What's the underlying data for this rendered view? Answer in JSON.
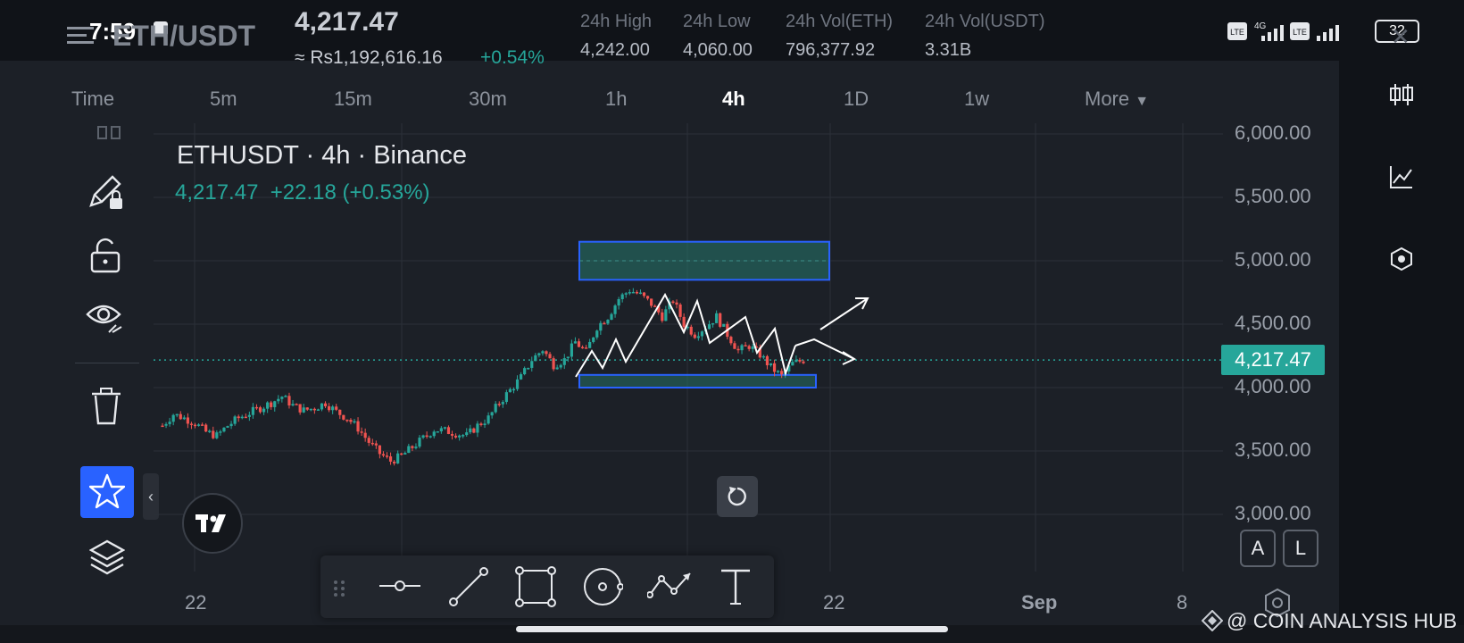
{
  "status": {
    "time": "7:59",
    "battery": "32",
    "net": "4G"
  },
  "header": {
    "symbol": "ETH/USDT",
    "price": "4,217.47",
    "fiat_price": "≈ Rs1,192,616.16",
    "change": "+0.54%",
    "stats": [
      {
        "label": "24h High",
        "value": "4,242.00"
      },
      {
        "label": "24h Low",
        "value": "4,060.00"
      },
      {
        "label": "24h Vol(ETH)",
        "value": "796,377.92"
      },
      {
        "label": "24h Vol(USDT)",
        "value": "3.31B"
      }
    ]
  },
  "timeframes": [
    "Time",
    "5m",
    "15m",
    "30m",
    "1h",
    "4h",
    "1D",
    "1w",
    "More"
  ],
  "active_timeframe": "4h",
  "legend": {
    "title": "ETHUSDT · 4h · Binance",
    "ohlc": "4,217.47  +22.18 (+0.53%)"
  },
  "price_axis": [
    "6,000.00",
    "5,500.00",
    "5,000.00",
    "4,500.00",
    "4,000.00",
    "3,500.00",
    "3,000.00"
  ],
  "time_axis": [
    "22",
    "22",
    "Sep",
    "8"
  ],
  "last_price_tag": "4,217.47",
  "scale_buttons": {
    "auto": "A",
    "log": "L"
  },
  "watermark": "@ COIN ANALYSIS HUB",
  "colors": {
    "up": "#26a69a",
    "down": "#ef5350",
    "accent": "#2962ff",
    "price_tag": "#26a69a"
  },
  "chart_data": {
    "type": "candlestick",
    "title": "ETHUSDT · 4h · Binance",
    "ylim": [
      2800,
      6100
    ],
    "last_price": 4217.47,
    "close_path": [
      3700,
      3790,
      3760,
      3720,
      3650,
      3620,
      3700,
      3760,
      3800,
      3840,
      3880,
      3930,
      3860,
      3820,
      3840,
      3880,
      3810,
      3760,
      3680,
      3570,
      3480,
      3420,
      3460,
      3530,
      3600,
      3670,
      3660,
      3640,
      3620,
      3700,
      3760,
      3880,
      3980,
      4080,
      4220,
      4300,
      4180,
      4220,
      4360,
      4280,
      4480,
      4560,
      4700,
      4770,
      4730,
      4660,
      4560,
      4690,
      4500,
      4420,
      4480,
      4560,
      4420,
      4290,
      4330,
      4260,
      4160,
      4090,
      4190,
      4217
    ],
    "zones": [
      {
        "name": "resistance",
        "from": 4850,
        "to": 5150
      },
      {
        "name": "support",
        "from": 4000,
        "to": 4100
      }
    ]
  }
}
